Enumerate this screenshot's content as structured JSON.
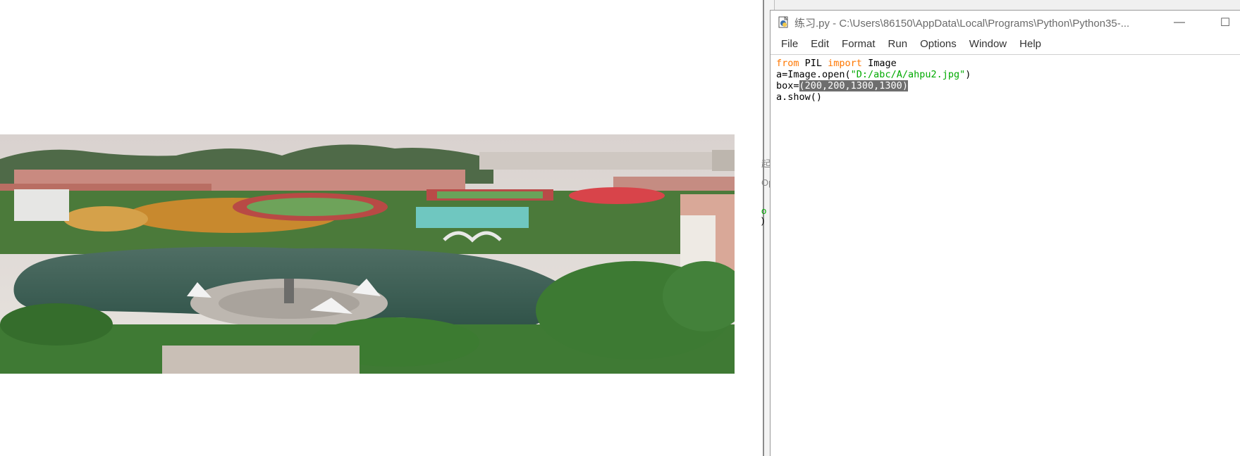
{
  "viewer": {
    "image_description_icon": "photo-campus-aerial"
  },
  "behind": {
    "frag1": "起",
    "frag2": "Op",
    "frag3": "o",
    "frag4": ")"
  },
  "idle": {
    "title": "练习.py - C:\\Users\\86150\\AppData\\Local\\Programs\\Python\\Python35-...",
    "minimize_label": "—",
    "maximize_label": "☐",
    "menu": [
      "File",
      "Edit",
      "Format",
      "Run",
      "Options",
      "Window",
      "Help"
    ],
    "code": {
      "line1": {
        "kw1": "from",
        "t1": " PIL ",
        "kw2": "import",
        "t2": " Image"
      },
      "line2": {
        "t1": "a=Image.open(",
        "str": "\"D:/abc/A/ahpu2.jpg\"",
        "t2": ")"
      },
      "line3": {
        "t1": "box=",
        "sel": "(200,200,1300,1300)"
      },
      "line4": {
        "t1": "a.show()"
      }
    }
  },
  "colors": {
    "keyword": "#ff7700",
    "string": "#00aa00",
    "selection": "#6e6e6e"
  }
}
